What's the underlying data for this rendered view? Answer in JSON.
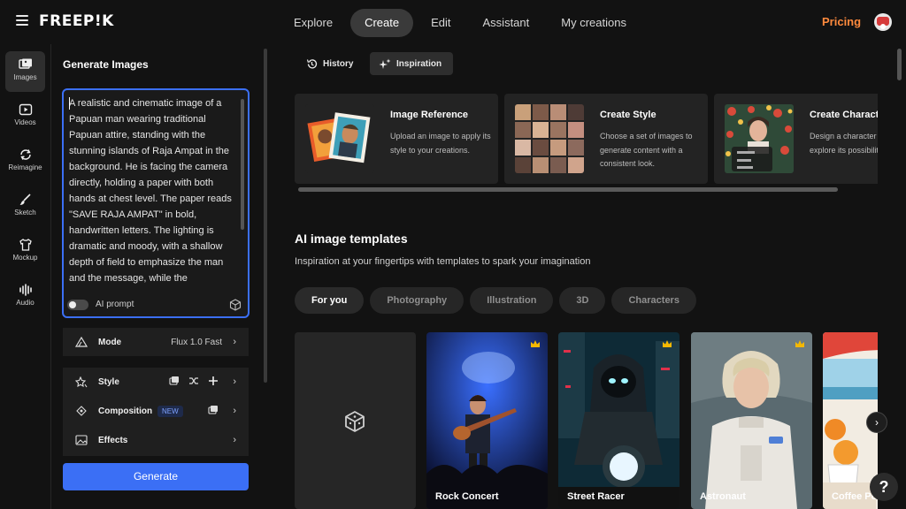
{
  "header": {
    "logo": "FREEP!K",
    "nav": [
      "Explore",
      "Create",
      "Edit",
      "Assistant",
      "My creations"
    ],
    "active_nav": "Create",
    "pricing": "Pricing"
  },
  "rail": {
    "items": [
      {
        "label": "Images",
        "icon": "image-icon"
      },
      {
        "label": "Videos",
        "icon": "video-icon"
      },
      {
        "label": "Reimagine",
        "icon": "refresh-icon"
      },
      {
        "label": "Sketch",
        "icon": "brush-icon"
      },
      {
        "label": "Mockup",
        "icon": "tshirt-icon"
      },
      {
        "label": "Audio",
        "icon": "audio-wave-icon"
      }
    ]
  },
  "panel": {
    "title": "Generate Images",
    "prompt": "A realistic and cinematic image of a Papuan man wearing traditional Papuan attire, standing with the stunning islands of Raja Ampat in the background. He is facing the camera directly, holding a paper with both hands at chest level. The paper reads \"SAVE RAJA AMPAT\" in bold, handwritten letters. The lighting is dramatic and moody, with a shallow depth of field to emphasize the man and the message, while the",
    "ai_prompt_label": "AI prompt",
    "mode_label": "Mode",
    "mode_value": "Flux 1.0 Fast",
    "style_label": "Style",
    "composition_label": "Composition",
    "composition_badge": "NEW",
    "effects_label": "Effects",
    "generate_label": "Generate"
  },
  "main": {
    "tabs": [
      {
        "label": "History",
        "icon": "history-icon"
      },
      {
        "label": "Inspiration",
        "icon": "sparkle-icon"
      }
    ],
    "active_tab": "Inspiration",
    "cards": [
      {
        "title": "Image Reference",
        "desc": "Upload an image to apply its style to your creations."
      },
      {
        "title": "Create Style",
        "desc": "Choose a set of images to generate content with a consistent look."
      },
      {
        "title": "Create Character",
        "desc": "Design a character and explore its possibilities"
      }
    ],
    "section_title": "AI image templates",
    "section_subtitle": "Inspiration at your fingertips with templates to spark your imagination",
    "filters": [
      "For you",
      "Photography",
      "Illustration",
      "3D",
      "Characters"
    ],
    "active_filter": "For you",
    "templates": [
      {
        "label": "Rock Concert",
        "premium": true
      },
      {
        "label": "Street Racer",
        "premium": true
      },
      {
        "label": "Astronaut",
        "premium": true
      },
      {
        "label": "Coffee Post",
        "premium": true
      }
    ],
    "help_label": "?"
  },
  "colors": {
    "accent": "#3b6ff5",
    "pricing": "#ff8a3d",
    "background": "#121212",
    "premium_crown": "#f5b800"
  }
}
